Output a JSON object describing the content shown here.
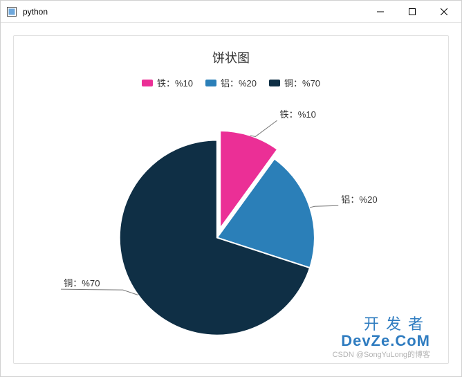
{
  "window": {
    "title": "python"
  },
  "chart": {
    "title": "饼状图"
  },
  "legend": {
    "items": [
      {
        "label": "铁：%10"
      },
      {
        "label": "铝：%20"
      },
      {
        "label": "铜：%70"
      }
    ]
  },
  "slice_labels": {
    "0": "铁：%10",
    "1": "铝：%20",
    "2": "铜：%70"
  },
  "watermark": {
    "line1": "开发者",
    "line2": "DevZe.CoM",
    "sub": "CSDN @SongYuLong的博客"
  },
  "chart_data": {
    "type": "pie",
    "title": "饼状图",
    "series": [
      {
        "name": "铁",
        "label": "铁：%10",
        "value": 10,
        "color": "#eb2f96",
        "exploded": true
      },
      {
        "name": "铝",
        "label": "铝：%20",
        "value": 20,
        "color": "#2b7fb8",
        "exploded": false
      },
      {
        "name": "铜",
        "label": "铜：%70",
        "value": 70,
        "color": "#0f2f45",
        "exploded": false
      }
    ],
    "legend_position": "top"
  }
}
